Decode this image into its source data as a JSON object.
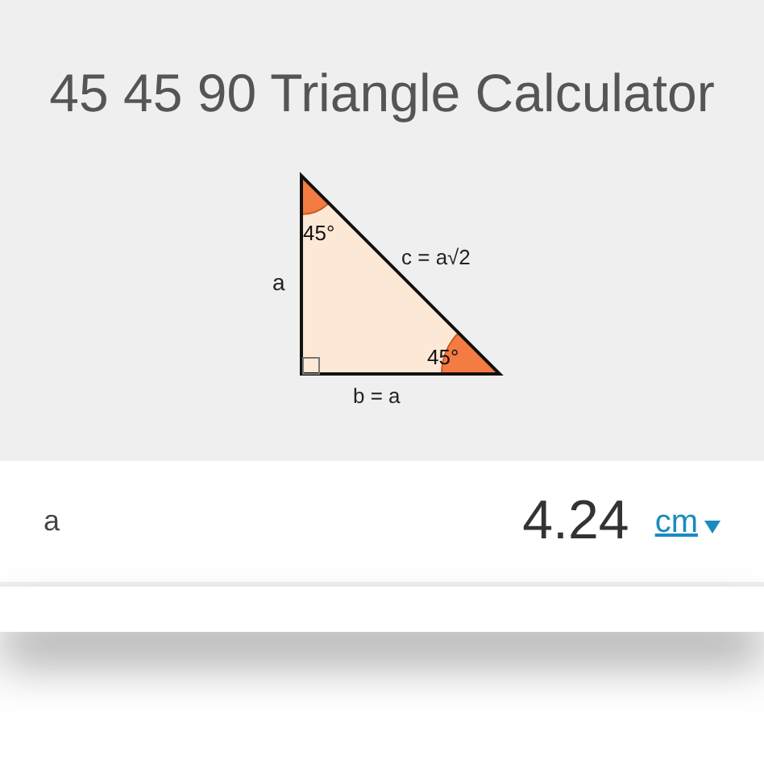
{
  "title": "45 45 90 Triangle Calculator",
  "diagram": {
    "top_angle": "45°",
    "bottom_angle": "45°",
    "side_a": "a",
    "hypotenuse": "c = a√2",
    "base": "b = a"
  },
  "rows": [
    {
      "label": "a",
      "value": "4.24",
      "unit": "cm"
    }
  ]
}
